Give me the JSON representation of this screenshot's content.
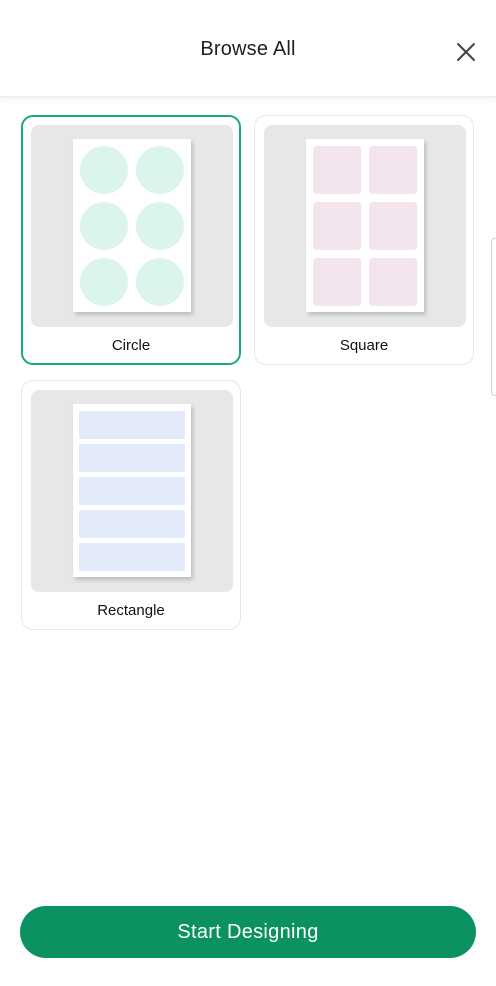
{
  "header": {
    "title": "Browse All",
    "close_icon": "close-icon"
  },
  "templates": [
    {
      "label": "Circle",
      "shape": "circle",
      "selected": true,
      "accent": "#dcf4ee"
    },
    {
      "label": "Square",
      "shape": "square",
      "selected": false,
      "accent": "#f4e4ee"
    },
    {
      "label": "Rectangle",
      "shape": "rectangle",
      "selected": false,
      "accent": "#e3ebfa"
    }
  ],
  "footer": {
    "start_label": "Start Designing"
  },
  "colors": {
    "selected_border": "#1aaa78",
    "primary_button": "#0c9160",
    "brand_red": "#e2263b"
  }
}
